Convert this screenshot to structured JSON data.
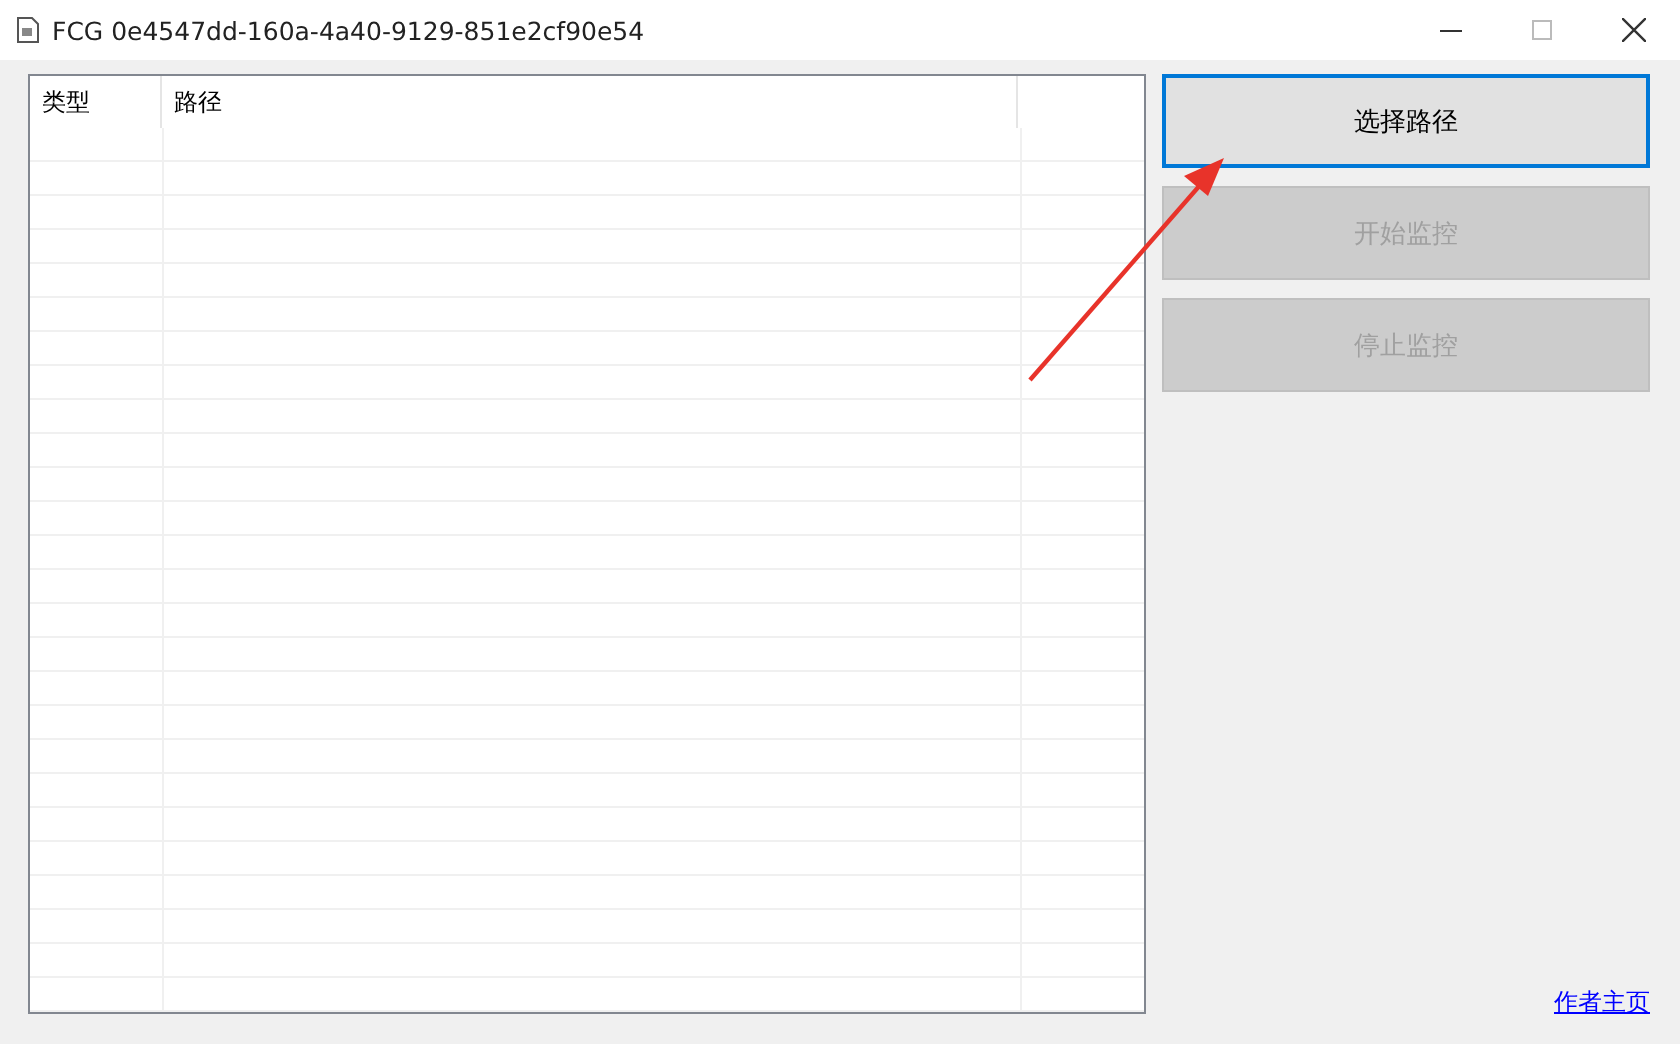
{
  "window": {
    "title": "FCG 0e4547dd-160a-4a40-9129-851e2cf90e54"
  },
  "table": {
    "columns": [
      "类型",
      "路径"
    ]
  },
  "buttons": [
    {
      "label": "选择路径",
      "disabled": false,
      "focused": true
    },
    {
      "label": "开始监控",
      "disabled": true,
      "focused": false
    },
    {
      "label": "停止监控",
      "disabled": true,
      "focused": false
    }
  ],
  "link": "作者主页"
}
